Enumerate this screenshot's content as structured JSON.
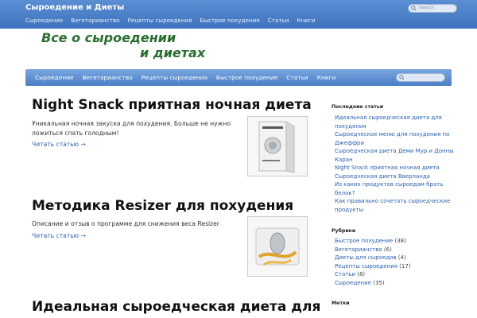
{
  "top": {
    "site_title": "Сыроедение и Диеты",
    "nav": [
      "Сыроедение",
      "Вегетарианство",
      "Рецепты сыроедения",
      "Быстрое похудение",
      "Статьи",
      "Книги"
    ],
    "search_placeholder": "Search"
  },
  "logo": {
    "line1": "Все о сыроедении",
    "line2": "и диетах"
  },
  "mainnav": {
    "items": [
      "Сыроедение",
      "Вегетарианство",
      "Рецепты сыроедения",
      "Быстрое похудение",
      "Статьи",
      "Книги"
    ]
  },
  "posts": [
    {
      "title": "Night Snack приятная ночная диета",
      "excerpt": "Уникальная ночная закуска для похудения. Больше не нужно ложиться спать голодным!",
      "more": "Читать статью →"
    },
    {
      "title": "Методика Resizer для похудения",
      "excerpt": "Описание и отзыв о программе для снижения веса Resizer",
      "more": "Читать статью →"
    },
    {
      "title": "Идеальная сыроедческая диета для"
    }
  ],
  "sidebar": {
    "recent_heading": "Последние статьи",
    "recent": [
      "Идеальная сыроедческая диета для похудения",
      "Сыроедческое меню для похудения по Джеффри",
      "Сыроедческая диета Деми Мур и Донны Каран",
      "Night Snack приятная ночная диета",
      "Сыроедческая диета Вверланда",
      "Из каких продуктов сыроедам брать белок?",
      "Как правильно сочетать сыроедческие продукты"
    ],
    "rubrics_heading": "Рубрики",
    "rubrics": [
      {
        "name": "Быстрое похудение",
        "count": "(38)"
      },
      {
        "name": "Вегетарианство",
        "count": "(6)"
      },
      {
        "name": "Диеты для сыроедов",
        "count": "(4)"
      },
      {
        "name": "Рецепты сыроедения",
        "count": "(17)"
      },
      {
        "name": "Статьи",
        "count": "(8)"
      },
      {
        "name": "Сыроедение",
        "count": "(35)"
      }
    ],
    "tags_heading": "Метки"
  },
  "colors": {
    "topbar": "#4a7ec6",
    "logo_green": "#2a6e2f",
    "link_blue": "#2a63b0"
  }
}
